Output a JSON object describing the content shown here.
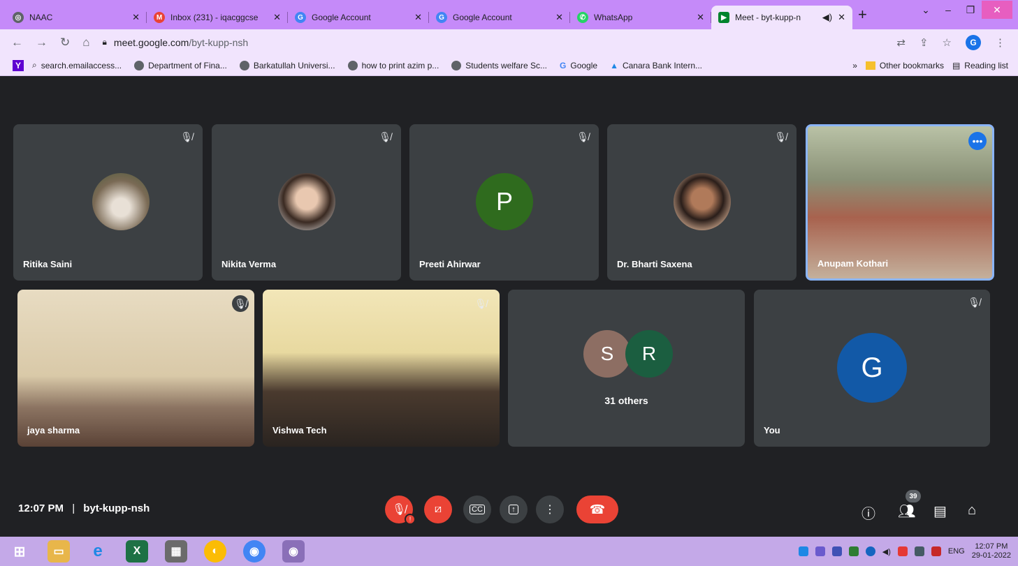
{
  "tabs": [
    {
      "title": "NAAC",
      "icon": "globe-icon",
      "color": "#5f6368"
    },
    {
      "title": "Inbox (231) - iqacggcse",
      "icon": "gmail-icon",
      "color": "#ea4335"
    },
    {
      "title": "Google Account",
      "icon": "google-icon",
      "color": "#4285f4"
    },
    {
      "title": "Google Account",
      "icon": "google-icon",
      "color": "#4285f4"
    },
    {
      "title": "WhatsApp",
      "icon": "whatsapp-icon",
      "color": "#25d366"
    },
    {
      "title": "Meet - byt-kupp-n",
      "icon": "meet-icon",
      "color": "#00832d"
    }
  ],
  "address": {
    "host": "meet.google.com",
    "path": "/byt-kupp-nsh",
    "profile": "G"
  },
  "bookmarks": [
    {
      "label": "search.emailaccess..."
    },
    {
      "label": "Department of Fina..."
    },
    {
      "label": "Barkatullah Universi..."
    },
    {
      "label": "how to print azim p..."
    },
    {
      "label": "Students welfare Sc..."
    },
    {
      "label": "Google"
    },
    {
      "label": "Canara Bank Intern..."
    }
  ],
  "bookmarks_right": {
    "chevron": "»",
    "other": "Other bookmarks",
    "reading": "Reading list"
  },
  "participants": {
    "p1": {
      "name": "Ritika Saini"
    },
    "p2": {
      "name": "Nikita Verma"
    },
    "p3": {
      "name": "Preeti Ahirwar",
      "initial": "P",
      "color": "#2f6b1e"
    },
    "p4": {
      "name": "Dr. Bharti Saxena"
    },
    "p5": {
      "name": "Anupam Kothari"
    },
    "p6": {
      "name": "jaya sharma"
    },
    "p7": {
      "name": "Vishwa Tech"
    },
    "others": {
      "label": "31 others",
      "a": "S",
      "b": "R",
      "acolor": "#8d6e63",
      "bcolor": "#1b5e40"
    },
    "you": {
      "name": "You",
      "initial": "G",
      "color": "#1259a7"
    }
  },
  "bottom": {
    "time": "12:07 PM",
    "separator": "|",
    "code": "byt-kupp-nsh",
    "people_count": "39"
  },
  "taskbar": {
    "lang": "ENG",
    "time": "12:07 PM",
    "date": "29-01-2022"
  }
}
